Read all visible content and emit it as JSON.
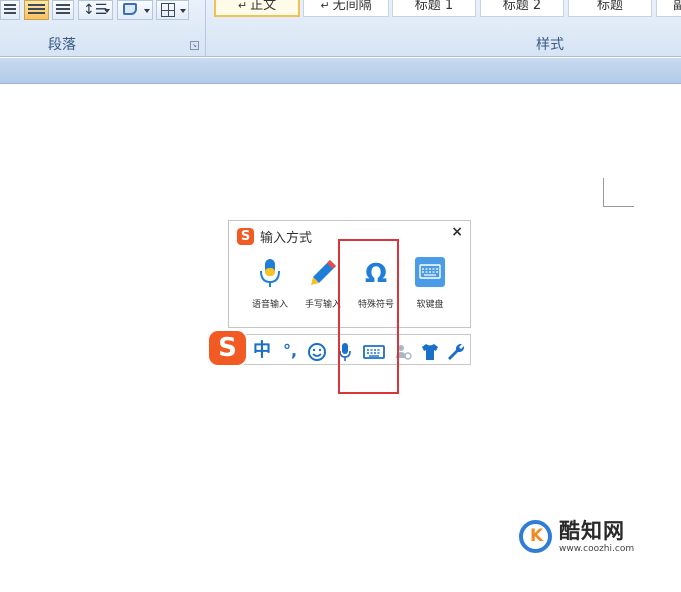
{
  "ribbon": {
    "paragraph_group_label": "段落",
    "styles_group_label": "样式",
    "style_cards": [
      "正文",
      "无间隔",
      "标题 1",
      "标题 2",
      "标题",
      "副"
    ],
    "selected_style": "正文"
  },
  "ime_panel": {
    "title": "输入方式",
    "close": "×",
    "items": [
      {
        "label": "语音输入",
        "icon": "microphone-icon"
      },
      {
        "label": "手写输入",
        "icon": "pencil-icon"
      },
      {
        "label": "特殊符号",
        "icon": "omega-icon"
      },
      {
        "label": "软键盘",
        "icon": "keyboard-icon"
      }
    ]
  },
  "ime_toolbar": {
    "logo": "S",
    "mode": "中",
    "punct": "°,",
    "icons": [
      "emoji-icon",
      "microphone-icon",
      "keyboard-icon",
      "user-icon",
      "shirt-icon",
      "wrench-icon"
    ]
  },
  "watermark": {
    "logo_letter": "K",
    "title": "酷知网",
    "url": "www.coozhi.com"
  },
  "colors": {
    "accent_blue": "#1a6fc8",
    "sogou_orange": "#f15a22",
    "highlight_red": "#d9353a"
  }
}
